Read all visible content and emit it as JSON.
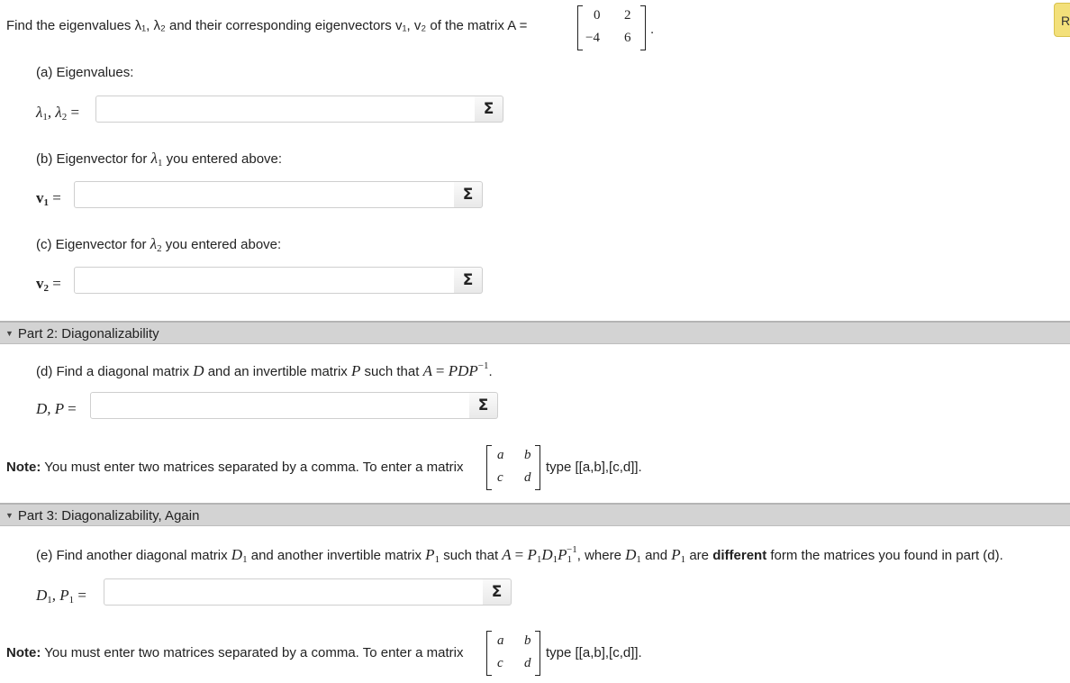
{
  "header": {
    "prompt": "Find the eigenvalues λ₁, λ₂ and their corresponding eigenvectors v₁, v₂ of the matrix A =",
    "matrix": [
      "0",
      "2",
      "−4",
      "6"
    ],
    "side_button": "R"
  },
  "part1": {
    "a_label": "(a) Eigenvalues:",
    "b_label_pre": "(b) Eigenvector for",
    "b_label_post": "you entered above:",
    "c_label_pre": "(c) Eigenvector for",
    "c_label_post": "you entered above:",
    "sigma": "Σ"
  },
  "part2": {
    "title": "Part 2: Diagonalizability",
    "d_pre": "(d) Find a diagonal matrix",
    "d_mid1": "and an invertible matrix",
    "d_mid2": "such that",
    "note_bold": "Note:",
    "note_text": "You must enter two matrices separated by a comma. To enter a matrix",
    "note_type": "type [[a,b],[c,d]]."
  },
  "part3": {
    "title": "Part 3: Diagonalizability, Again",
    "e_pre": "(e) Find another diagonal matrix",
    "e_mid1": "and another invertible matrix",
    "e_mid2": "such that",
    "e_where": ", where",
    "e_and": "and",
    "e_are": "are",
    "e_different": "different",
    "e_end": "form the matrices you found in part (d).",
    "note_bold": "Note:",
    "note_text": "You must enter two matrices separated by a comma. To enter a matrix",
    "note_type": "type [[a,b],[c,d]]."
  },
  "example_matrix": [
    "a",
    "b",
    "c",
    "d"
  ]
}
